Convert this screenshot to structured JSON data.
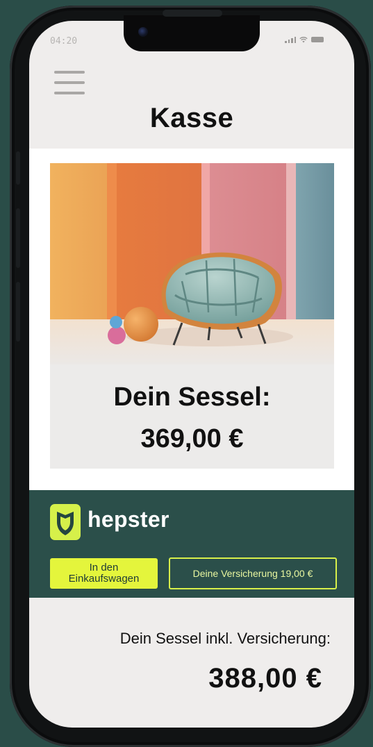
{
  "status_bar": {
    "time": "04:20"
  },
  "header": {
    "menu_icon": "hamburger-menu-icon",
    "title": "Kasse"
  },
  "product": {
    "name_label": "Dein Sessel:",
    "price": "369,00 €",
    "image_subject": "armchair"
  },
  "hepster": {
    "brand": "hepster",
    "logo_icon": "hepster-shield-logo-icon",
    "add_to_cart_line1": "In den",
    "add_to_cart_line2": "Einkaufswagen",
    "insurance_label": "Deine Versicherung 19,00 €"
  },
  "summary": {
    "total_label": "Dein Sessel inkl. Versicherung:",
    "total_value": "388,00 €"
  },
  "colors": {
    "background": "#2a4d48",
    "screen": "#efedec",
    "accent": "#e4f53c",
    "band": "#2b4f4a"
  }
}
